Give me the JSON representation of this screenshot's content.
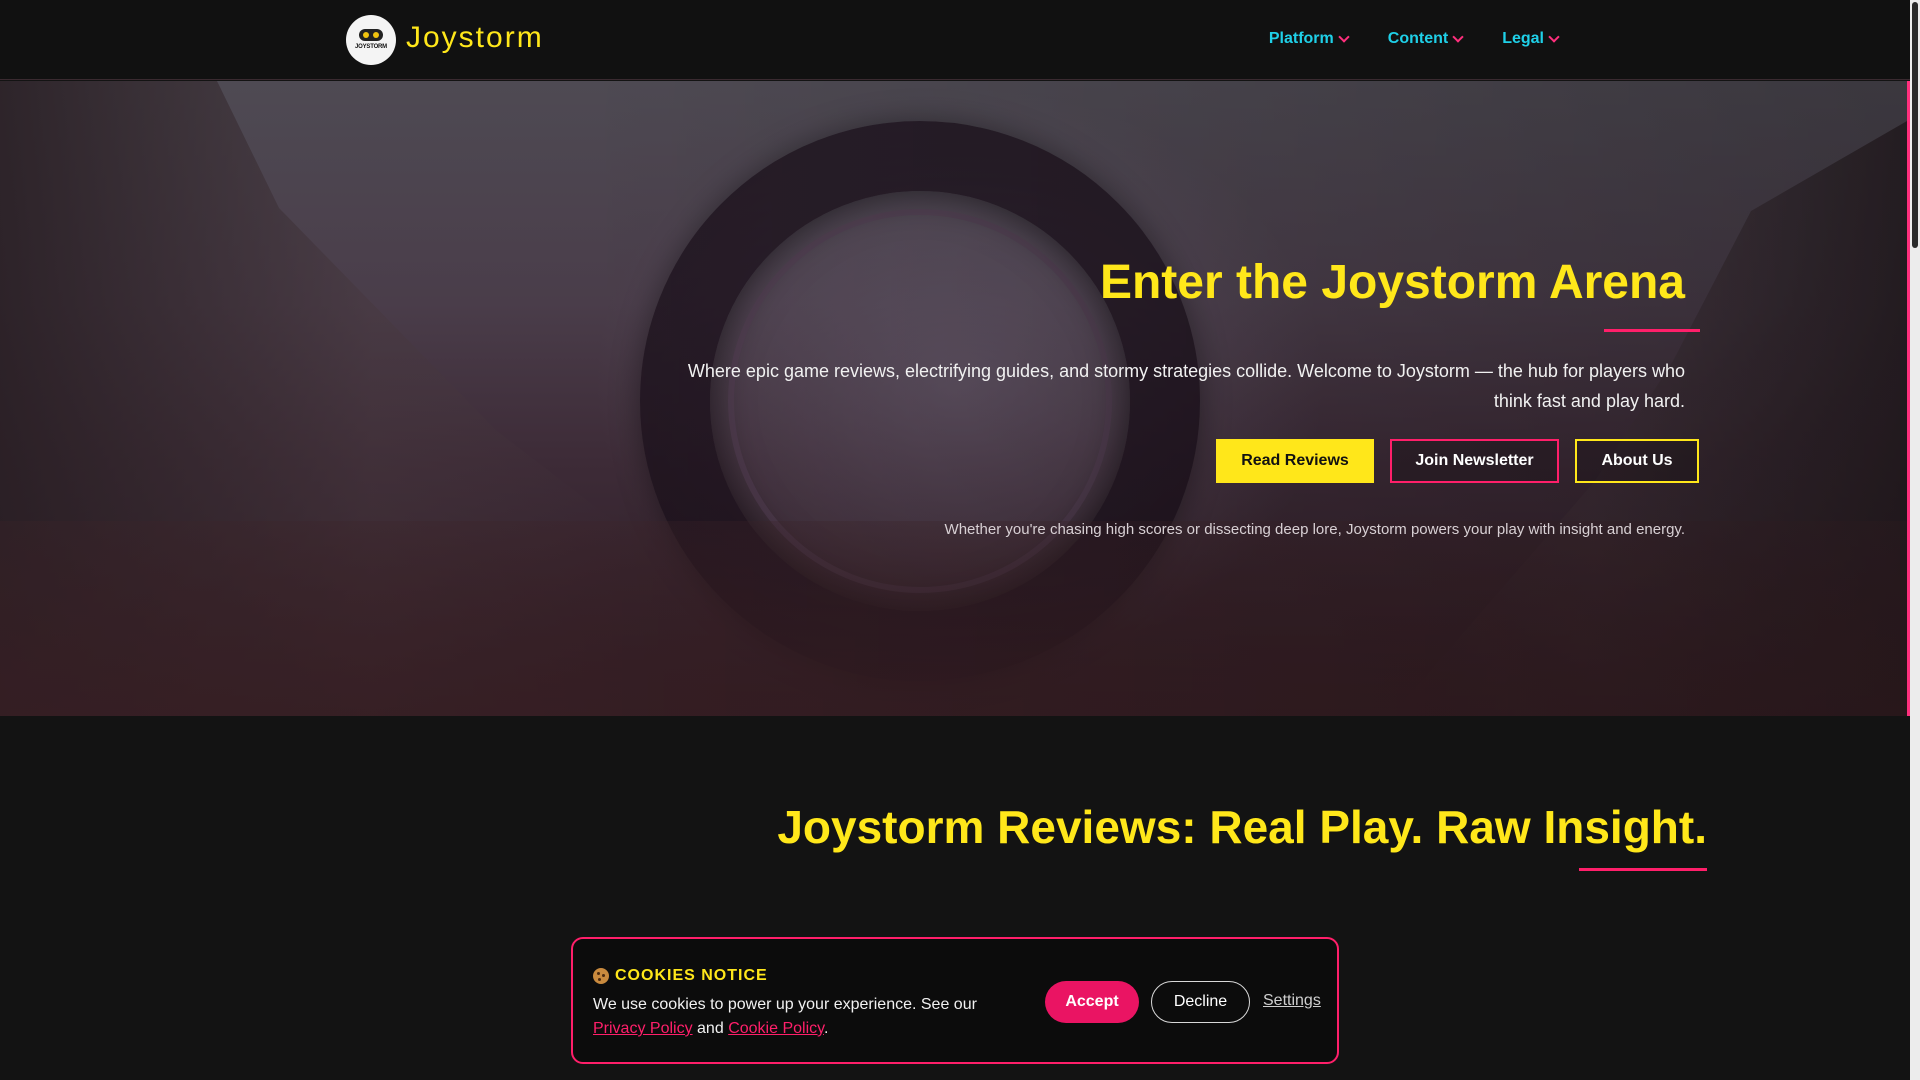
{
  "header": {
    "logo_text": "JOYSTORM",
    "brand": "Joystorm",
    "nav": [
      {
        "label": "Platform"
      },
      {
        "label": "Content"
      },
      {
        "label": "Legal"
      }
    ]
  },
  "hero": {
    "title": "Enter the Joystorm Arena",
    "description": "Where epic game reviews, electrifying guides, and stormy strategies collide. Welcome to Joystorm — the hub for players who think fast and play hard.",
    "buttons": {
      "reviews": "Read Reviews",
      "newsletter": "Join Newsletter",
      "about": "About Us"
    },
    "note": "Whether you're chasing high scores or dissecting deep lore, Joystorm powers your play with insight and energy."
  },
  "section": {
    "title": "Joystorm Reviews: Real Play. Raw Insight."
  },
  "cookie": {
    "heading": "COOKIES NOTICE",
    "text_before": "We use cookies to power up your experience. See our",
    "privacy_link": "Privacy Policy",
    "and": "and",
    "cookie_link": "Cookie Policy",
    "period": ".",
    "accept": "Accept",
    "decline": "Decline",
    "settings": "Settings"
  },
  "colors": {
    "accent_yellow": "#ffe71a",
    "accent_pink": "#ff1f6a",
    "nav_cyan": "#1fd0e8",
    "background": "#131313"
  }
}
